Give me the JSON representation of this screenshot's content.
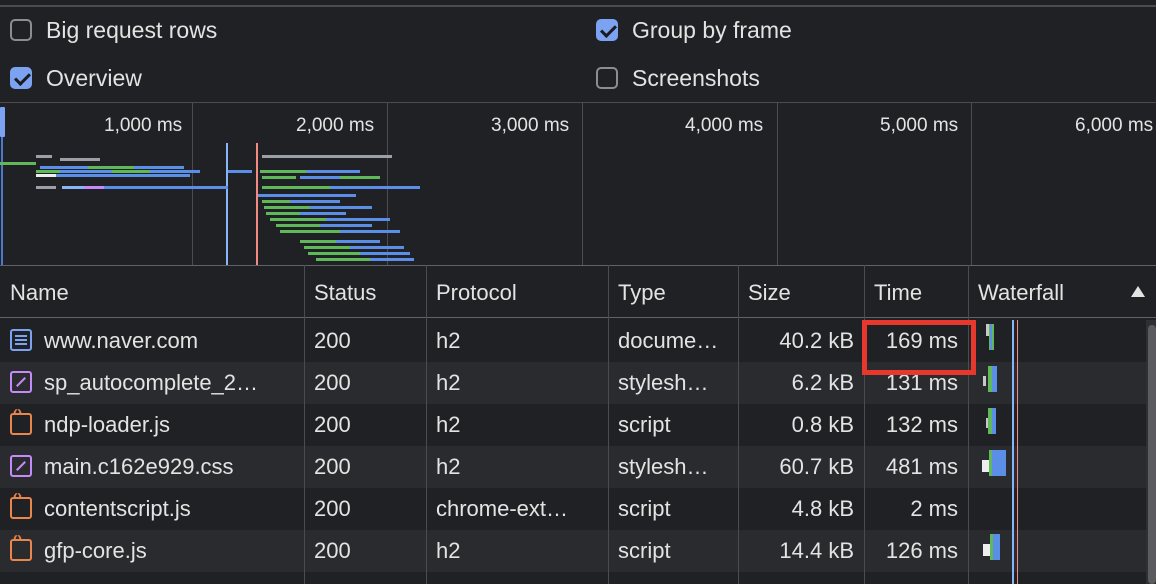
{
  "options": {
    "big_request_rows": {
      "label": "Big request rows",
      "checked": false
    },
    "group_by_frame": {
      "label": "Group by frame",
      "checked": true
    },
    "overview": {
      "label": "Overview",
      "checked": true
    },
    "screenshots": {
      "label": "Screenshots",
      "checked": false
    }
  },
  "overview": {
    "ticks": [
      "1,000 ms",
      "2,000 ms",
      "3,000 ms",
      "4,000 ms",
      "5,000 ms",
      "6,000 ms"
    ]
  },
  "columns": [
    "Name",
    "Status",
    "Protocol",
    "Type",
    "Size",
    "Time",
    "Waterfall"
  ],
  "rows": [
    {
      "icon": "document-icon",
      "name": "www.naver.com",
      "status": "200",
      "protocol": "h2",
      "type": "docume…",
      "size": "40.2 kB",
      "time": "169 ms"
    },
    {
      "icon": "stylesheet-icon",
      "name": "sp_autocomplete_2…",
      "status": "200",
      "protocol": "h2",
      "type": "stylesh…",
      "size": "6.2 kB",
      "time": "131 ms"
    },
    {
      "icon": "script-icon",
      "name": "ndp-loader.js",
      "status": "200",
      "protocol": "h2",
      "type": "script",
      "size": "0.8 kB",
      "time": "132 ms"
    },
    {
      "icon": "stylesheet-icon",
      "name": "main.c162e929.css",
      "status": "200",
      "protocol": "h2",
      "type": "stylesh…",
      "size": "60.7 kB",
      "time": "481 ms"
    },
    {
      "icon": "script-icon",
      "name": "contentscript.js",
      "status": "200",
      "protocol": "chrome-ext…",
      "type": "script",
      "size": "4.8 kB",
      "time": "2 ms"
    },
    {
      "icon": "script-icon",
      "name": "gfp-core.js",
      "status": "200",
      "protocol": "h2",
      "type": "script",
      "size": "14.4 kB",
      "time": "126 ms"
    }
  ],
  "colors": {
    "accent": "#7ca2f2",
    "highlight": "#e8372c",
    "green": "#5fb85a",
    "blue": "#5b8ee6"
  }
}
